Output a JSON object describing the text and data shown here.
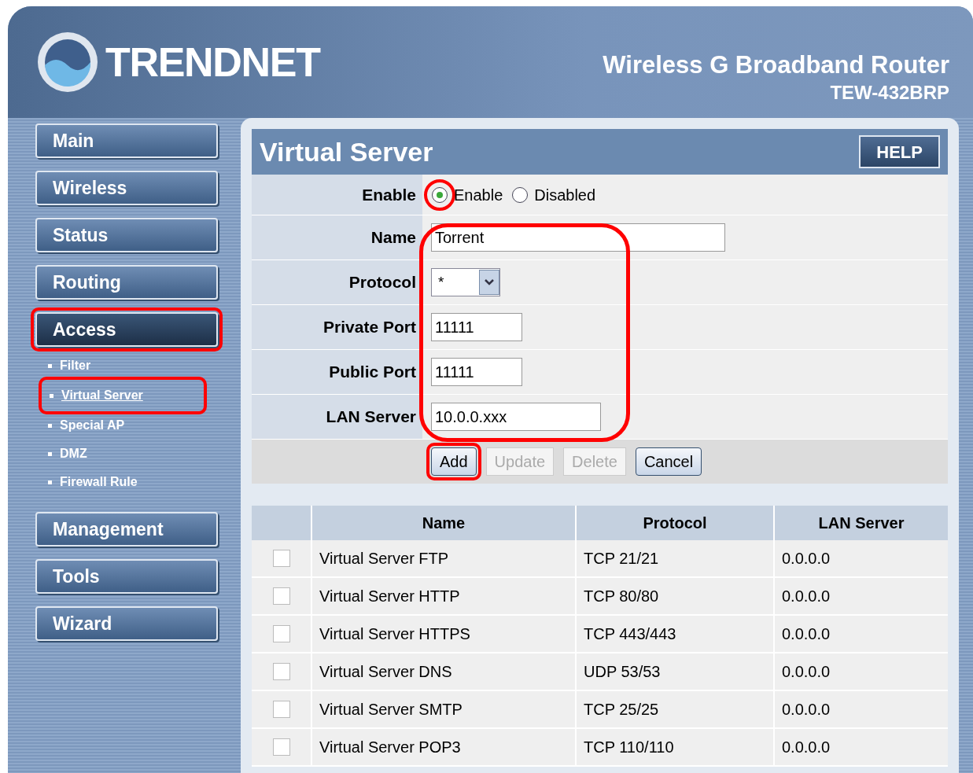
{
  "header": {
    "brand": "TRENDNET",
    "product": "Wireless G Broadband Router",
    "model": "TEW-432BRP"
  },
  "sidebar": {
    "items": [
      {
        "label": "Main",
        "selected": false
      },
      {
        "label": "Wireless",
        "selected": false
      },
      {
        "label": "Status",
        "selected": false
      },
      {
        "label": "Routing",
        "selected": false
      },
      {
        "label": "Access",
        "selected": true,
        "children": [
          {
            "label": "Filter",
            "selected": false
          },
          {
            "label": "Virtual Server",
            "selected": true
          },
          {
            "label": "Special AP",
            "selected": false
          },
          {
            "label": "DMZ",
            "selected": false
          },
          {
            "label": "Firewall Rule",
            "selected": false
          }
        ]
      },
      {
        "label": "Management",
        "selected": false
      },
      {
        "label": "Tools",
        "selected": false
      },
      {
        "label": "Wizard",
        "selected": false
      }
    ]
  },
  "panel": {
    "title": "Virtual Server",
    "help": "HELP"
  },
  "form": {
    "enable": {
      "label": "Enable",
      "options": [
        {
          "label": "Enable",
          "selected": true
        },
        {
          "label": "Disabled",
          "selected": false
        }
      ]
    },
    "fields": [
      {
        "label": "Name",
        "kind": "text",
        "value": "Torrent"
      },
      {
        "label": "Protocol",
        "kind": "select",
        "value": "*"
      },
      {
        "label": "Private Port",
        "kind": "text",
        "value": "11111"
      },
      {
        "label": "Public Port",
        "kind": "text",
        "value": "11111"
      },
      {
        "label": "LAN Server",
        "kind": "text",
        "value": "10.0.0.xxx"
      }
    ],
    "buttons": [
      {
        "label": "Add",
        "disabled": false
      },
      {
        "label": "Update",
        "disabled": true
      },
      {
        "label": "Delete",
        "disabled": true
      },
      {
        "label": "Cancel",
        "disabled": false
      }
    ]
  },
  "table": {
    "columns": [
      "Name",
      "Protocol",
      "LAN Server"
    ],
    "rows": [
      {
        "checked": false,
        "name": "Virtual Server FTP",
        "protocol": "TCP 21/21",
        "lan_server": "0.0.0.0"
      },
      {
        "checked": false,
        "name": "Virtual Server HTTP",
        "protocol": "TCP 80/80",
        "lan_server": "0.0.0.0"
      },
      {
        "checked": false,
        "name": "Virtual Server HTTPS",
        "protocol": "TCP 443/443",
        "lan_server": "0.0.0.0"
      },
      {
        "checked": false,
        "name": "Virtual Server DNS",
        "protocol": "UDP 53/53",
        "lan_server": "0.0.0.0"
      },
      {
        "checked": false,
        "name": "Virtual Server SMTP",
        "protocol": "TCP 25/25",
        "lan_server": "0.0.0.0"
      },
      {
        "checked": false,
        "name": "Virtual Server POP3",
        "protocol": "TCP 110/110",
        "lan_server": "0.0.0.0"
      }
    ]
  }
}
